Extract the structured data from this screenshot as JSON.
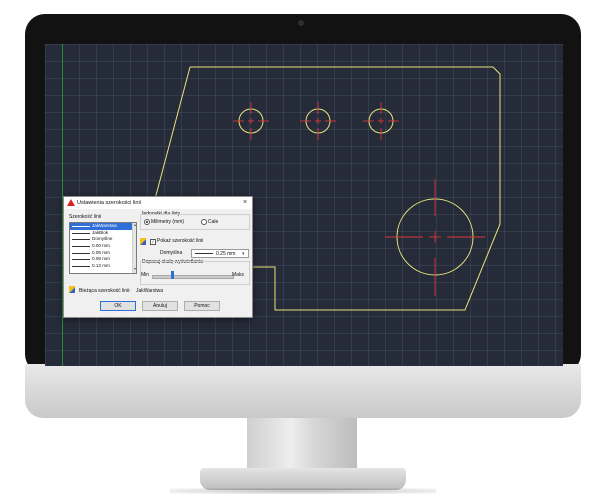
{
  "dialog": {
    "title": "Ustawienia szerokości linii",
    "close_label": "×",
    "lineweights_label": "Szerokość linii",
    "lineweights": [
      "JakWarstwa",
      "JakBlok",
      "Domyślne",
      "0.00 mm",
      "0.05 mm",
      "0.09 mm",
      "0.13 mm"
    ],
    "selected_index": 0,
    "units_label": "Jednostki dla listy",
    "unit_mm": "Milimetry (mm)",
    "unit_in": "Cale",
    "unit_selected": "mm",
    "show_label": "Pokaż szerokość linii",
    "show_checked": true,
    "default_label": "Domyślna",
    "default_value": "0.25 mm",
    "scale_label": "Dopasuj skalę wyświetlania",
    "min_label": "Min",
    "max_label": "Maks",
    "scale_level": 0.25,
    "current_label": "Bieżąca szerokość linii:",
    "current_value": "JakWarstwa",
    "ok_label": "OK",
    "cancel_label": "Anuluj",
    "help_label": "Pomoc"
  },
  "colors": {
    "drawing_line": "#e7e27a",
    "center_marks": "#e0343a",
    "background": "#252b38",
    "accent": "#2f6fd8"
  }
}
